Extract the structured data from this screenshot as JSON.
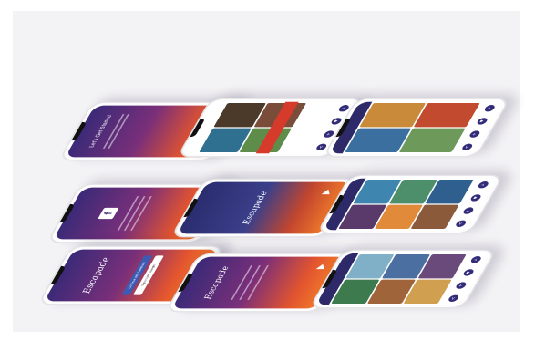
{
  "scene": {
    "description_hidden": false,
    "accent_colors": {
      "purple": "#3b2a78",
      "orange": "#f07a2a",
      "nav": "#2e2a6a"
    }
  },
  "phones": {
    "onboarding_title": "Let's Get Started",
    "facebook_glyph": "f",
    "brand_name": "Escapade",
    "login_facebook_label": "Continue with Facebook",
    "login_google_label": "Sign in with Google",
    "nav_icons": [
      "share-icon",
      "add-icon",
      "heart-icon",
      "search-icon"
    ]
  }
}
